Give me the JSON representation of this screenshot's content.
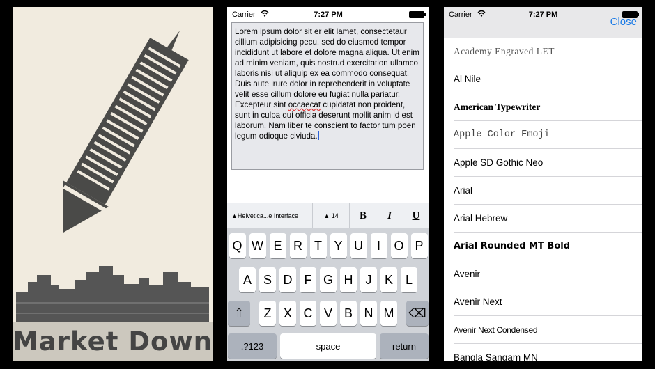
{
  "panel1": {
    "title": "Market Down"
  },
  "status": {
    "carrier": "Carrier",
    "time": "7:27 PM"
  },
  "editor": {
    "text_main": "Lorem ipsum dolor sit er elit lamet, consectetaur cillium adipisicing pecu, sed do eiusmod tempor incididunt ut labore et dolore magna aliqua. Ut enim ad minim veniam, quis nostrud exercitation ullamco laboris nisi ut aliquip ex ea commodo consequat. Duis aute irure dolor in reprehenderit in voluptate velit esse cillum dolore eu fugiat nulla pariatur. Excepteur sint ",
    "text_misspelled": "occaecat",
    "text_end": " cupidatat non proident, sunt in culpa qui officia deserunt mollit anim id est laborum. Nam liber te conscient to factor tum poen legum odioque civiuda."
  },
  "format_bar": {
    "font": "▲Helvetica...e Interface",
    "size": "▲ 14",
    "bold": "B",
    "italic": "I",
    "underline": "U"
  },
  "keyboard": {
    "row1": [
      "Q",
      "W",
      "E",
      "R",
      "T",
      "Y",
      "U",
      "I",
      "O",
      "P"
    ],
    "row2": [
      "A",
      "S",
      "D",
      "F",
      "G",
      "H",
      "J",
      "K",
      "L"
    ],
    "row3": [
      "Z",
      "X",
      "C",
      "V",
      "B",
      "N",
      "M"
    ],
    "shift": "⇧",
    "delete": "⌫",
    "numbers": ".?123",
    "space": "space",
    "return": "return"
  },
  "font_picker": {
    "close": "Close",
    "fonts": [
      "Academy Engraved LET",
      "Al Nile",
      "American Typewriter",
      "Apple  Color  Emoji",
      "Apple SD Gothic Neo",
      "Arial",
      "Arial Hebrew",
      "Arial Rounded MT Bold",
      "Avenir",
      "Avenir Next",
      "Avenir Next Condensed",
      "Bangla Sangam MN"
    ]
  }
}
